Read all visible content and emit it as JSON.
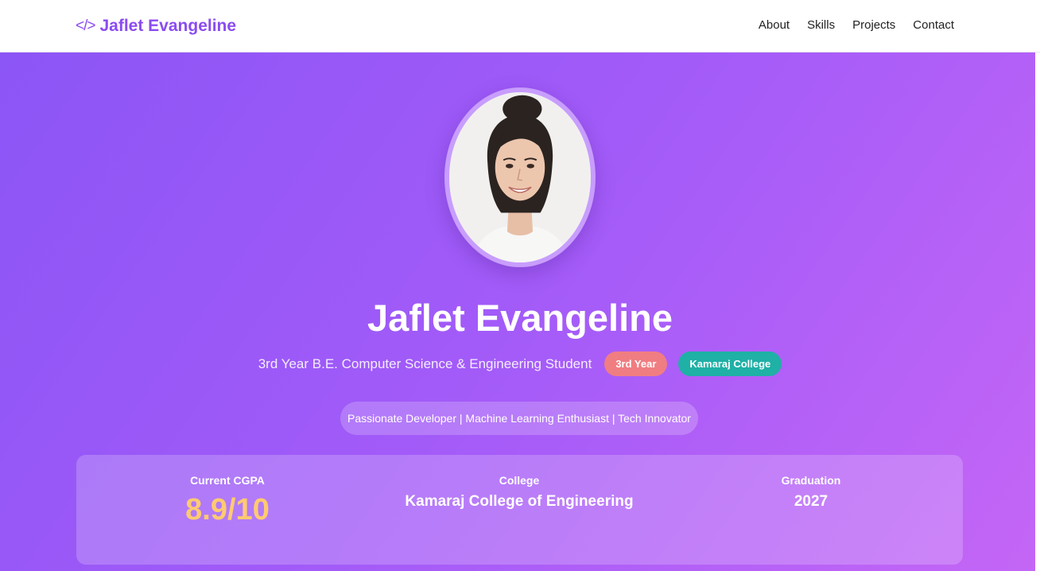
{
  "nav": {
    "logo_icon": "</>",
    "logo_text": "Jaflet Evangeline",
    "links": [
      "About",
      "Skills",
      "Projects",
      "Contact"
    ]
  },
  "hero": {
    "avatar_icon": "profile-photo",
    "name": "Jaflet Evangeline",
    "subtitle": "3rd Year B.E. Computer Science & Engineering Student",
    "badges": [
      "3rd Year",
      "Kamaraj College"
    ],
    "tagline": "Passionate Developer | Machine Learning Enthusiast | Tech Innovator"
  },
  "stats": {
    "cgpa_label": "Current CGPA",
    "cgpa_value": "8.9/10",
    "college_label": "College",
    "college_value": "Kamaraj College of Engineering",
    "graduation_label": "Graduation",
    "graduation_value": "2027"
  },
  "colors": {
    "brand": "#8b4cf0",
    "hero_gradient_start": "#8c55f6",
    "hero_gradient_end": "#c466f6",
    "badge_year": "#f07d82",
    "badge_college": "#1fb0a6",
    "cgpa_value": "#ffca70"
  }
}
